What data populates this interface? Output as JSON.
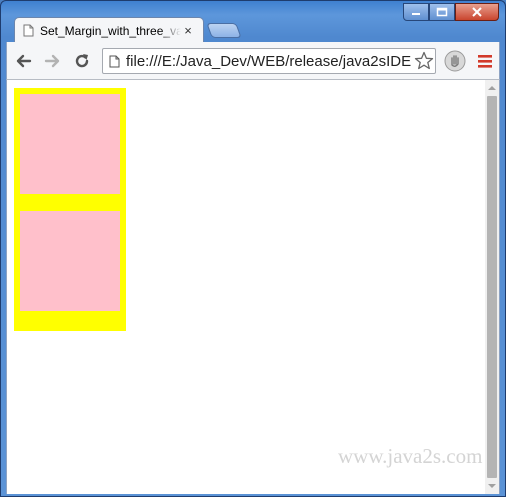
{
  "tab": {
    "title": "Set_Margin_with_three_values",
    "close_glyph": "×"
  },
  "toolbar": {
    "url": "file:///E:/Java_Dev/WEB/release/java2sIDE",
    "back_icon": "arrow-left-icon",
    "forward_icon": "arrow-right-icon",
    "reload_icon": "reload-icon",
    "star_icon": "star-icon",
    "extension_icon": "hand-icon",
    "menu_icon": "hamburger-menu-icon"
  },
  "page": {
    "outer_color": "#ffff00",
    "inner_color": "#ffc0cb",
    "watermark": "www.java2s.com"
  },
  "colors": {
    "menu_red": "#d23a2a",
    "frame_blue": "#4f88cf"
  }
}
